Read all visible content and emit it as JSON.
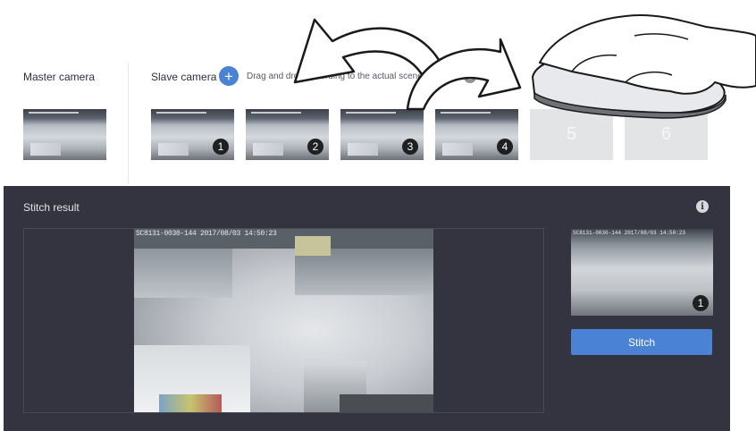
{
  "master": {
    "label": "Master camera"
  },
  "slave": {
    "label": "Slave camera",
    "add_icon": "plus-icon",
    "hint": "Drag and drop according to the actual scenes",
    "info_icon": "info-icon",
    "slots": [
      {
        "number": "1",
        "filled": true
      },
      {
        "number": "2",
        "filled": true
      },
      {
        "number": "3",
        "filled": true
      },
      {
        "number": "4",
        "filled": true
      },
      {
        "number": "5",
        "filled": false
      },
      {
        "number": "6",
        "filled": false
      }
    ]
  },
  "stitch": {
    "title": "Stitch result",
    "info_icon": "info-icon",
    "overlay_text": "SC8131-0030-144 2017/08/03 14:50:23",
    "mini_overlay_text": "SC8131-0030-144 2017/08/03 14:50:23",
    "selected_number": "1",
    "button_label": "Stitch"
  },
  "colors": {
    "accent": "#4a83d6",
    "panel": "#33343f",
    "empty_slot": "#e3e4e6"
  }
}
